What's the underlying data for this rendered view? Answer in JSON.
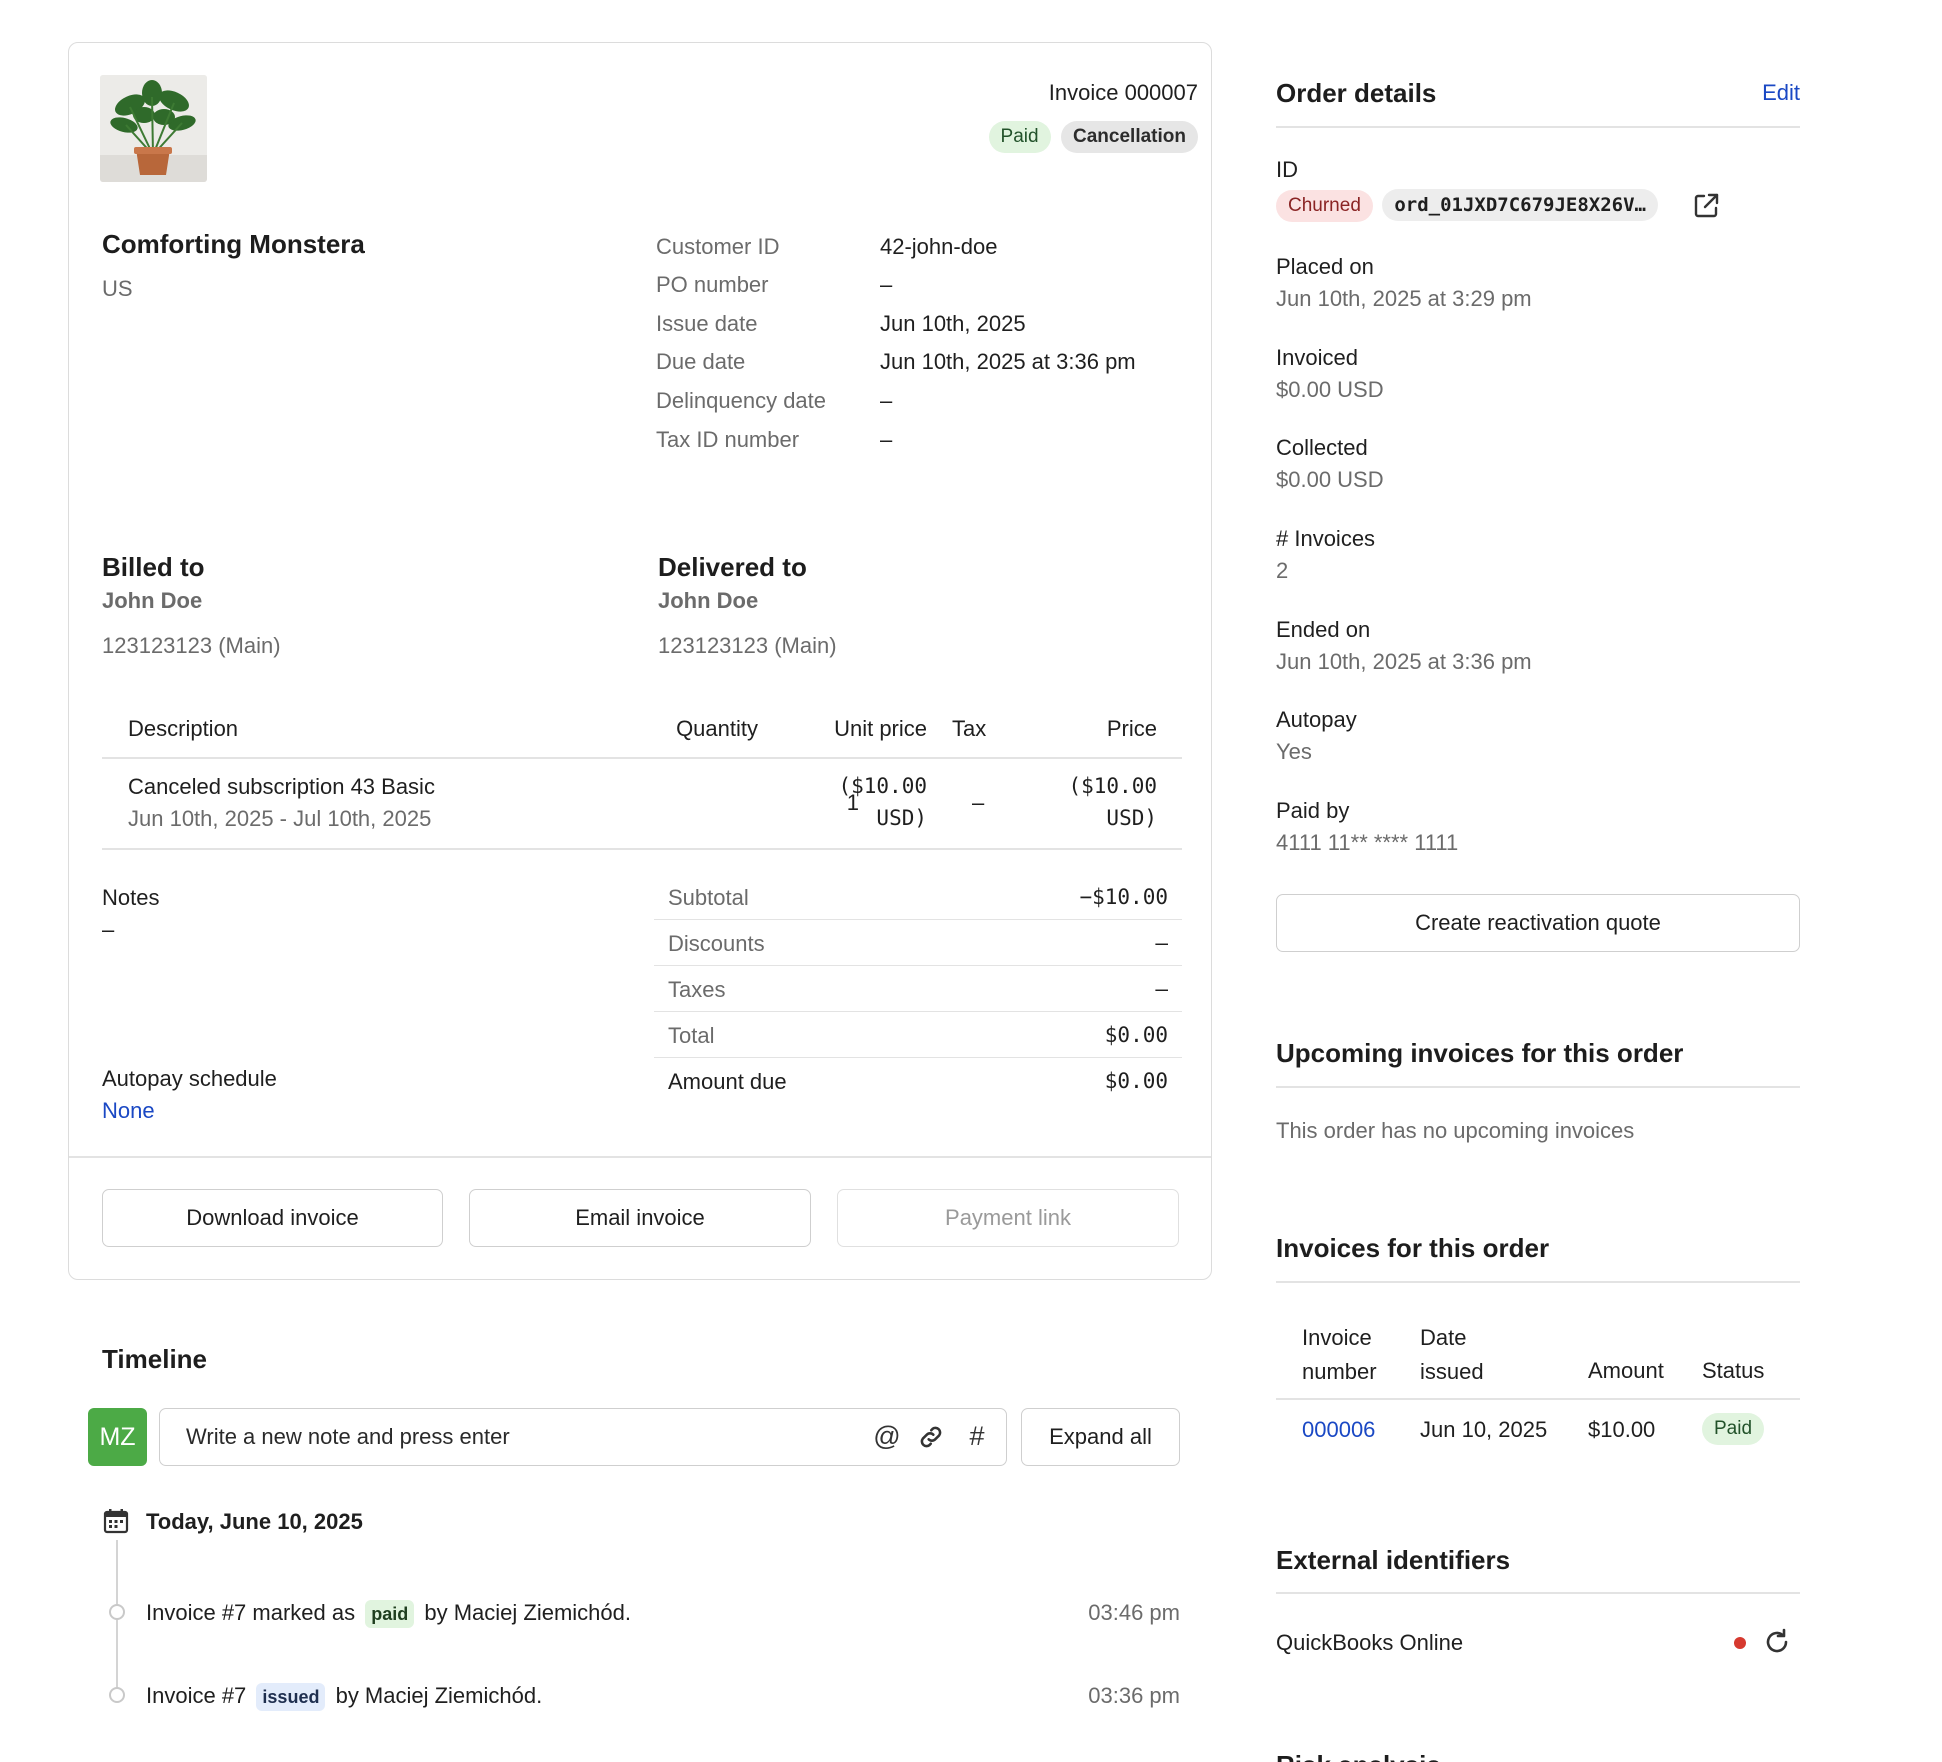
{
  "invoice": {
    "number_label": "Invoice 000007",
    "badges": {
      "paid": "Paid",
      "cancellation": "Cancellation"
    },
    "product_name": "Comforting Monstera",
    "country": "US",
    "meta": [
      {
        "label": "Customer ID",
        "value": "42-john-doe"
      },
      {
        "label": "PO number",
        "value": "–"
      },
      {
        "label": "Issue date",
        "value": "Jun 10th, 2025"
      },
      {
        "label": "Due date",
        "value": "Jun 10th, 2025 at 3:36 pm"
      },
      {
        "label": "Delinquency date",
        "value": "–"
      },
      {
        "label": "Tax ID number",
        "value": "–"
      }
    ],
    "billed_to": {
      "heading": "Billed to",
      "name": "John Doe",
      "phone": "123123123 (Main)"
    },
    "delivered_to": {
      "heading": "Delivered to",
      "name": "John Doe",
      "phone": "123123123 (Main)"
    },
    "table": {
      "headers": {
        "description": "Description",
        "quantity": "Quantity",
        "unit_price": "Unit price",
        "tax": "Tax",
        "price": "Price"
      },
      "rows": [
        {
          "description": "Canceled subscription 43 Basic",
          "period": "Jun 10th, 2025 - Jul 10th, 2025",
          "quantity": "1",
          "unit_price_line1": "($10.00",
          "unit_price_line2": "USD)",
          "tax": "–",
          "price_line1": "($10.00",
          "price_line2": "USD)"
        }
      ]
    },
    "notes": {
      "label": "Notes",
      "value": "–"
    },
    "autopay_schedule": {
      "label": "Autopay schedule",
      "value": "None"
    },
    "totals": [
      {
        "label": "Subtotal",
        "value": "−$10.00"
      },
      {
        "label": "Discounts",
        "value": "–"
      },
      {
        "label": "Taxes",
        "value": "–"
      },
      {
        "label": "Total",
        "value": "$0.00"
      },
      {
        "label": "Amount due",
        "value": "$0.00"
      }
    ],
    "buttons": {
      "download": "Download invoice",
      "email": "Email invoice",
      "payment_link": "Payment link"
    }
  },
  "timeline": {
    "heading": "Timeline",
    "avatar_initials": "MZ",
    "note_placeholder": "Write a new note and press enter",
    "expand_all": "Expand all",
    "date_heading": "Today, June 10, 2025",
    "events": [
      {
        "prefix": "Invoice #7 marked as",
        "tag": "paid",
        "suffix": "by Maciej Ziemichód.",
        "time": "03:46 pm"
      },
      {
        "prefix": "Invoice #7",
        "tag": "issued",
        "suffix": "by Maciej Ziemichód.",
        "time": "03:36 pm"
      }
    ]
  },
  "order_details": {
    "heading": "Order details",
    "edit": "Edit",
    "id_label": "ID",
    "status_badge": "Churned",
    "order_id": "ord_01JXD7C679JE8X26V…",
    "fields": [
      {
        "label": "Placed on",
        "value": "Jun 10th, 2025 at 3:29 pm"
      },
      {
        "label": "Invoiced",
        "value": "$0.00 USD"
      },
      {
        "label": "Collected",
        "value": "$0.00 USD"
      },
      {
        "label": "# Invoices",
        "value": "2"
      },
      {
        "label": "Ended on",
        "value": "Jun 10th, 2025 at 3:36 pm"
      },
      {
        "label": "Autopay",
        "value": "Yes"
      },
      {
        "label": "Paid by",
        "value": "4111 11** **** 1111"
      }
    ],
    "reactivation_button": "Create reactivation quote"
  },
  "upcoming_invoices": {
    "heading": "Upcoming invoices for this order",
    "empty_text": "This order has no upcoming invoices"
  },
  "order_invoices": {
    "heading": "Invoices for this order",
    "headers": {
      "number_l1": "Invoice",
      "number_l2": "number",
      "date_l1": "Date",
      "date_l2": "issued",
      "amount": "Amount",
      "status": "Status"
    },
    "rows": [
      {
        "number": "000006",
        "date": "Jun 10, 2025",
        "amount": "$10.00",
        "status": "Paid"
      }
    ]
  },
  "external_identifiers": {
    "heading": "External identifiers",
    "items": [
      {
        "name": "QuickBooks Online"
      }
    ]
  },
  "risk_analysis": {
    "heading": "Risk analysis"
  },
  "colors": {
    "link": "#1a48c4",
    "paid_bg": "#e1f4df",
    "churned_bg": "#fbe2e2",
    "avatar": "#4caa46",
    "status_dot": "#d6392f"
  }
}
